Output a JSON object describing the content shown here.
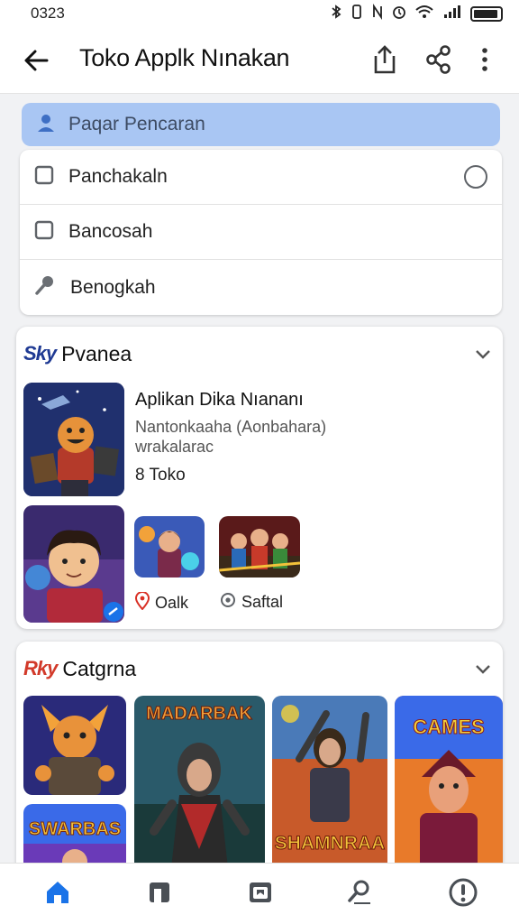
{
  "status": {
    "time": "0323",
    "icons": [
      "bluetooth-icon",
      "vibrate-icon",
      "nfc-icon",
      "alarm-icon",
      "wifi-icon",
      "signal-icon",
      "battery-icon"
    ]
  },
  "appbar": {
    "title": "Toko Applk Nınakan",
    "back_icon": "arrow-left-icon",
    "actions": [
      "share-upload-icon",
      "share-icon",
      "more-vert-icon"
    ]
  },
  "search": {
    "placeholder": "Paqar Pencaran",
    "icon": "person-icon"
  },
  "menu": {
    "items": [
      {
        "label": "Panchakaln",
        "icon": "square-icon"
      },
      {
        "label": "Bancosah",
        "icon": "square-icon"
      },
      {
        "label": "Benogkah",
        "icon": "key-icon"
      }
    ]
  },
  "featured": {
    "logo": "Sky",
    "title": "Pvanea",
    "app_name": "Aplikan Dika Nıananı",
    "app_desc": "Nantonkaaha (Aonbahara) wrakalarac",
    "store_count": "8 Toko",
    "tags": [
      {
        "label": "Oalk",
        "icon": "location-pin-icon",
        "color": "#d93025"
      },
      {
        "label": "Saftal",
        "icon": "target-icon",
        "color": "#5f6368"
      }
    ]
  },
  "category": {
    "logo": "Rky",
    "title": "Catgrna",
    "posters": [
      "MADARBAK",
      "SHAMNRAA",
      "CAMES",
      "SWARBAS"
    ]
  },
  "colors": {
    "accent": "#1a73e8",
    "search_bg": "#a9c6f3"
  },
  "bottom_nav": [
    "home-icon",
    "apps-icon",
    "library-icon",
    "updates-icon",
    "info-icon"
  ]
}
